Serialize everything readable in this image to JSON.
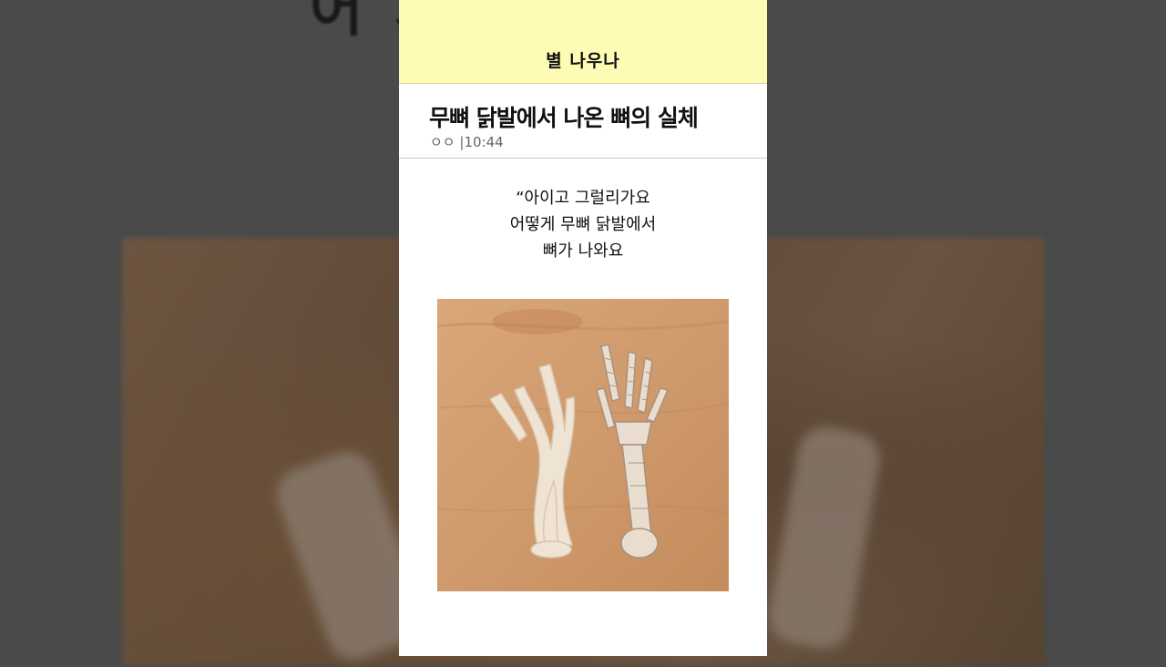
{
  "background": {
    "title_fragment": "어                          지"
  },
  "brand": {
    "name": "별 나우나",
    "bar_color": "#fefbb5"
  },
  "article": {
    "headline": "무뼈 닭발에서 나온 뼈의 실체",
    "author": "ㅇㅇ",
    "separator": "|",
    "time": "10:44",
    "quote_lines": [
      "“아이고 그럴리가요",
      "어떻게 무뼈 닭발에서",
      "뼈가 나와요"
    ],
    "photo_icon": "chicken-feet-bones-photo"
  }
}
